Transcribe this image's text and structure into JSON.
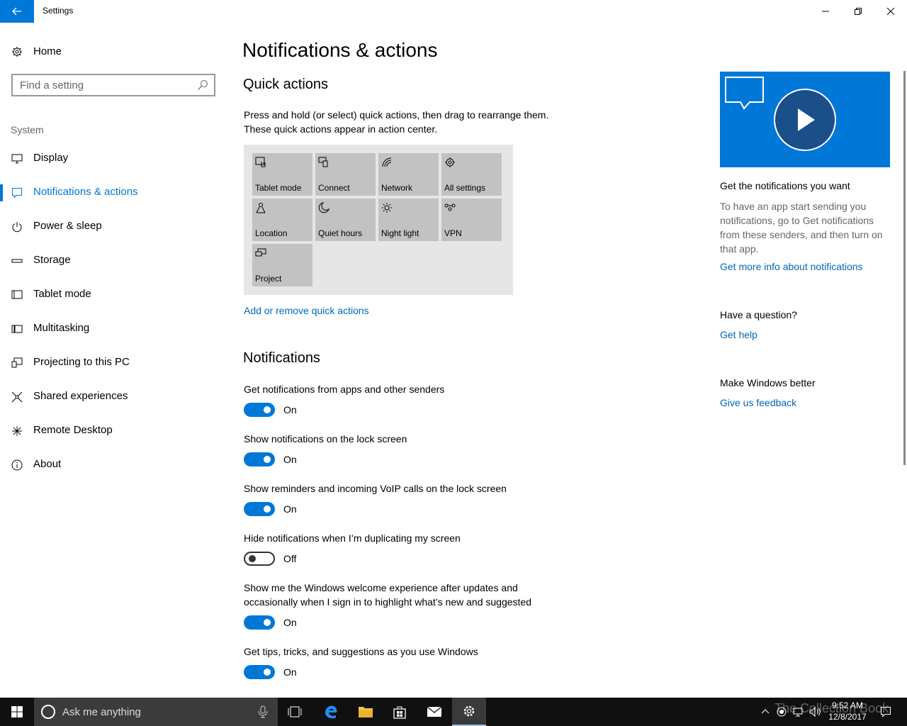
{
  "window": {
    "title": "Settings"
  },
  "sidebar": {
    "home_label": "Home",
    "search_placeholder": "Find a setting",
    "group_label": "System",
    "items": [
      {
        "label": "Display",
        "icon": "display-icon"
      },
      {
        "label": "Notifications & actions",
        "icon": "notifications-icon",
        "active": true
      },
      {
        "label": "Power & sleep",
        "icon": "power-icon"
      },
      {
        "label": "Storage",
        "icon": "storage-icon"
      },
      {
        "label": "Tablet mode",
        "icon": "tablet-icon"
      },
      {
        "label": "Multitasking",
        "icon": "multitasking-icon"
      },
      {
        "label": "Projecting to this PC",
        "icon": "projecting-icon"
      },
      {
        "label": "Shared experiences",
        "icon": "shared-experiences-icon"
      },
      {
        "label": "Remote Desktop",
        "icon": "remote-desktop-icon"
      },
      {
        "label": "About",
        "icon": "info-icon"
      }
    ]
  },
  "main": {
    "page_title": "Notifications & actions",
    "quick_actions": {
      "heading": "Quick actions",
      "description": "Press and hold (or select) quick actions, then drag to rearrange them. These quick actions appear in action center.",
      "tiles": [
        {
          "label": "Tablet mode",
          "icon": "tablet-mode-icon"
        },
        {
          "label": "Connect",
          "icon": "connect-icon"
        },
        {
          "label": "Network",
          "icon": "network-icon"
        },
        {
          "label": "All settings",
          "icon": "gear-icon"
        },
        {
          "label": "Location",
          "icon": "location-icon"
        },
        {
          "label": "Quiet hours",
          "icon": "moon-icon"
        },
        {
          "label": "Night light",
          "icon": "sun-icon"
        },
        {
          "label": "VPN",
          "icon": "vpn-icon"
        },
        {
          "label": "Project",
          "icon": "project-icon"
        }
      ],
      "add_remove_link": "Add or remove quick actions"
    },
    "notifications": {
      "heading": "Notifications",
      "settings": [
        {
          "label": "Get notifications from apps and other senders",
          "state": "On",
          "on": true
        },
        {
          "label": "Show notifications on the lock screen",
          "state": "On",
          "on": true
        },
        {
          "label": "Show reminders and incoming VoIP calls on the lock screen",
          "state": "On",
          "on": true
        },
        {
          "label": "Hide notifications when I’m duplicating my screen",
          "state": "Off",
          "on": false
        },
        {
          "label": "Show me the Windows welcome experience after updates and occasionally when I sign in to highlight what’s new and suggested",
          "state": "On",
          "on": true
        },
        {
          "label": "Get tips, tricks, and suggestions as you use Windows",
          "state": "On",
          "on": true
        }
      ]
    }
  },
  "right_column": {
    "video_icon": "play-icon",
    "info_heading": "Get the notifications you want",
    "info_text": "To have an app start sending you notifications, go to Get notifications from these senders, and then turn on that app.",
    "info_link": "Get more info about notifications",
    "question_heading": "Have a question?",
    "help_link": "Get help",
    "feedback_heading": "Make Windows better",
    "feedback_link": "Give us feedback"
  },
  "taskbar": {
    "search_placeholder": "Ask me anything",
    "time": "9:52 AM",
    "date": "12/8/2017",
    "watermark": "The Collection Book"
  },
  "colors": {
    "accent": "#0078d7",
    "link": "#0067b8",
    "tile": "#c2c2c2",
    "panel": "#e6e6e6",
    "taskbar": "#101010"
  }
}
